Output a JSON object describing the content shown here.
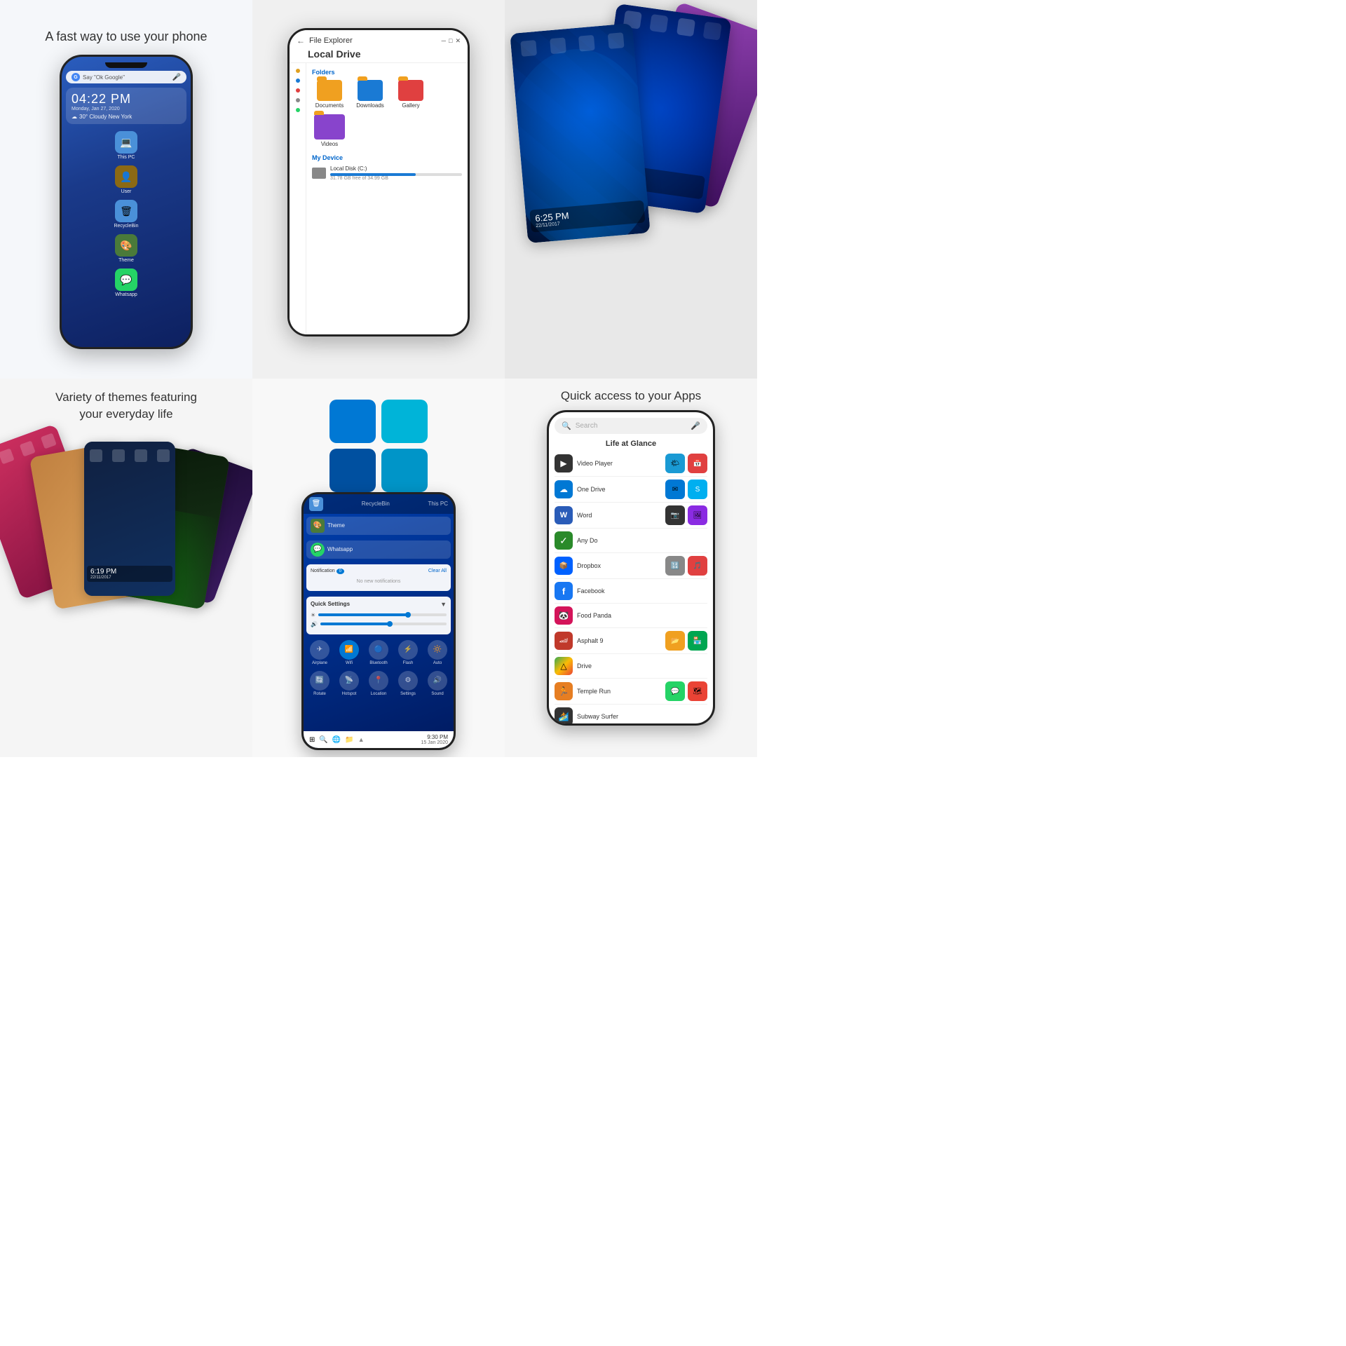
{
  "captions": {
    "top_left": "A fast way to use your phone",
    "bottom_left_line1": "Variety of themes featuring",
    "bottom_left_line2": "your everyday life",
    "bottom_right": "Quick access to your Apps"
  },
  "phone_launcher": {
    "search_placeholder": "Say \"Ok Google\"",
    "time": "04:22 PM",
    "date": "Monday, Jan 27, 2020",
    "weather": "30° Cloudy New York",
    "icons": [
      {
        "label": "This PC",
        "color": "#4a90d9",
        "emoji": "💻"
      },
      {
        "label": "User",
        "color": "#8b6914",
        "emoji": "👤"
      },
      {
        "label": "RecycleBin",
        "color": "#4a90d9",
        "emoji": "🗑️"
      },
      {
        "label": "Theme",
        "color": "#4a7a3a",
        "emoji": "🎨"
      },
      {
        "label": "Whatsapp",
        "color": "#25d366",
        "emoji": "💬"
      }
    ]
  },
  "file_explorer": {
    "title": "File Explorer",
    "drive_title": "Local Drive",
    "folders_section": "Folders",
    "my_device_section": "My Device",
    "folders": [
      {
        "name": "Documents",
        "color": "#f0a020"
      },
      {
        "name": "Downloads",
        "color": "#1a7ad4"
      },
      {
        "name": "Gallery",
        "color": "#e04040"
      },
      {
        "name": "Videos",
        "color": "#8844cc"
      }
    ],
    "disk_name": "Local Disk (C:)",
    "disk_size": "31.78 GB free of 34.99 GB"
  },
  "theme_cards": {
    "time1": "6:25 PM",
    "date1": "22/11/2017",
    "time2": "6:25 PM",
    "date2": "22/11/2017"
  },
  "windows_logo": {
    "tiles": [
      "#0078d4",
      "#00b4d8",
      "#0050a0",
      "#0095c8"
    ]
  },
  "quick_settings": {
    "notification_label": "Notification",
    "notification_count": "0",
    "clear_all": "Clear All",
    "no_notifications": "No new notifications",
    "section_title": "Quick Settings",
    "toggles_row1": [
      {
        "label": "Airplane",
        "icon": "✈",
        "active": false
      },
      {
        "label": "Wifi",
        "icon": "📶",
        "active": true
      },
      {
        "label": "Bluetooth",
        "icon": "🔵",
        "active": false
      },
      {
        "label": "Flash",
        "icon": "⚡",
        "active": false
      },
      {
        "label": "Auto",
        "icon": "🔆",
        "active": false
      }
    ],
    "toggles_row2": [
      {
        "label": "Rotate",
        "icon": "🔄",
        "active": false
      },
      {
        "label": "Hotspot",
        "icon": "📡",
        "active": false
      },
      {
        "label": "Location",
        "icon": "📍",
        "active": false
      },
      {
        "label": "Settings",
        "icon": "⚙",
        "active": false
      },
      {
        "label": "Sound",
        "icon": "🔊",
        "active": false
      }
    ],
    "bottom_time": "9:30 PM",
    "bottom_date": "15 Jan 2020"
  },
  "app_panel": {
    "search_placeholder": "Search",
    "section_title": "Life at Glance",
    "rows": [
      {
        "name": "Video Player",
        "icon_class": "icon-video",
        "icon": "▶"
      },
      {
        "name": "One Drive",
        "icon_class": "icon-onedrive",
        "icon": "☁"
      },
      {
        "name": "Word",
        "icon_class": "icon-word",
        "icon": "W"
      },
      {
        "name": "Any Do",
        "icon_class": "icon-anydo",
        "icon": "✓"
      },
      {
        "name": "Dropbox",
        "icon_class": "icon-dropbox",
        "icon": "📦"
      },
      {
        "name": "Facebook",
        "icon_class": "icon-facebook",
        "icon": "f"
      },
      {
        "name": "Food Panda",
        "icon_class": "icon-panda",
        "icon": "🐼"
      },
      {
        "name": "Asphalt 9",
        "icon_class": "icon-asphalt",
        "icon": "🏎"
      },
      {
        "name": "Drive",
        "icon_class": "icon-drive",
        "icon": "△"
      },
      {
        "name": "Temple Run",
        "icon_class": "icon-temple",
        "icon": "🏃"
      },
      {
        "name": "Subway Surfer",
        "icon_class": "icon-subway",
        "icon": "🏄"
      }
    ]
  }
}
